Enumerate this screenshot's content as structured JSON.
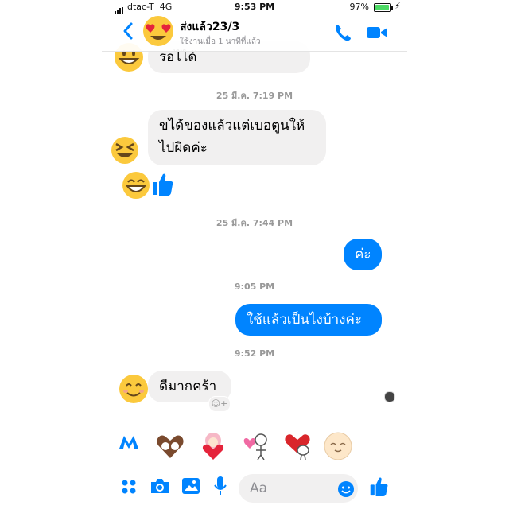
{
  "status_bar": {
    "carrier": "dtac-T",
    "network": "4G",
    "time": "9:53 PM",
    "battery": "97%"
  },
  "header": {
    "name": "ส่งแล้ว23/3",
    "status": "ใช้งานเมื่อ 1 นาทีที่แล้ว"
  },
  "messages": [
    {
      "dir": "in",
      "text": "รอไได้"
    },
    {
      "ts": "25 มี.ค. 7:19 PM"
    },
    {
      "dir": "in",
      "line1": "ขได้ของแล้วแต่เบอตูนให้",
      "line2": "ไปผิดค่ะ"
    },
    {
      "ts": "25 มี.ค. 7:44 PM"
    },
    {
      "dir": "out",
      "text": "ค่ะ"
    },
    {
      "ts": "9:05 PM"
    },
    {
      "dir": "out",
      "text": "ใช้แล้วเป็นไงบ้างค่ะ"
    },
    {
      "ts": "9:52 PM"
    },
    {
      "dir": "in",
      "text": "ดีมากคร้า"
    }
  ],
  "composer": {
    "placeholder": "Aa"
  },
  "colors": {
    "messenger_blue": "#0084ff",
    "incoming_bubble": "#f1f0f0",
    "timestamp": "#999999"
  },
  "icons": [
    "back-chevron-icon",
    "phone-icon",
    "video-camera-icon",
    "apps-icon",
    "camera-icon",
    "photo-icon",
    "microphone-icon",
    "emoji-icon",
    "like-icon",
    "reaction-icon",
    "messenger-m-icon"
  ]
}
